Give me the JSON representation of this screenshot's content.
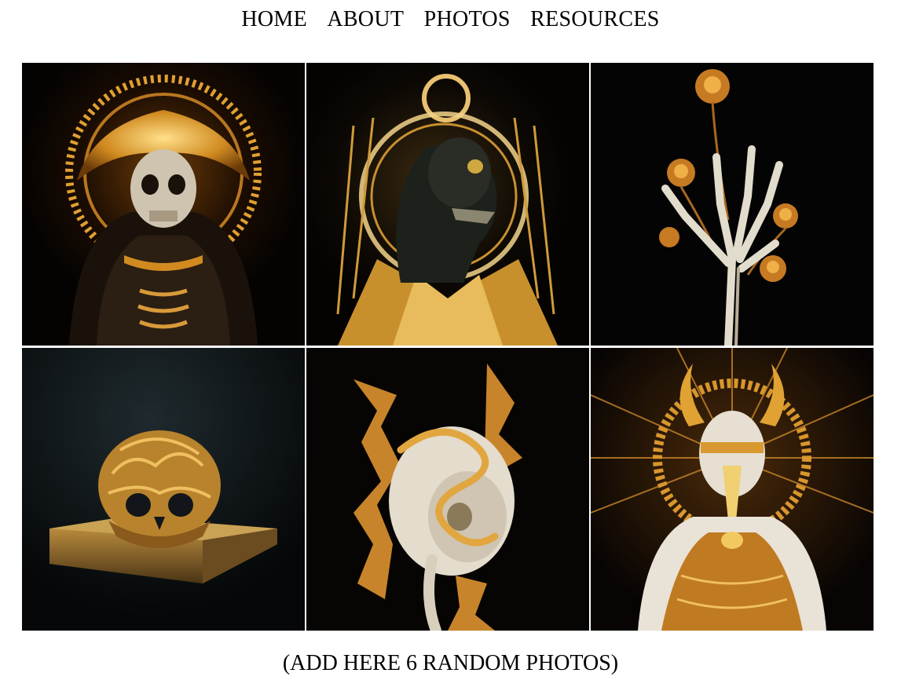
{
  "nav": {
    "items": [
      {
        "label": "HOME"
      },
      {
        "label": "ABOUT"
      },
      {
        "label": "PHOTOS"
      },
      {
        "label": "RESOURCES"
      }
    ]
  },
  "gallery": {
    "photos": [
      {
        "subject": "golden-haloed-skull-with-veil"
      },
      {
        "subject": "dark-skull-figure-with-golden-halo"
      },
      {
        "subject": "skeletal-hand-with-golden-roses"
      },
      {
        "subject": "ornate-golden-skull-on-pedestal"
      },
      {
        "subject": "white-skull-with-golden-serpent"
      },
      {
        "subject": "horned-golden-masked-figure"
      }
    ]
  },
  "caption": {
    "text": "(ADD HERE 6 RANDOM PHOTOS)"
  },
  "colors": {
    "background": "#ffffff",
    "text": "#000000",
    "tile_background": "#060606",
    "gold": "#d99a2b",
    "gold_light": "#f5d070",
    "bone": "#ddd6c8"
  }
}
